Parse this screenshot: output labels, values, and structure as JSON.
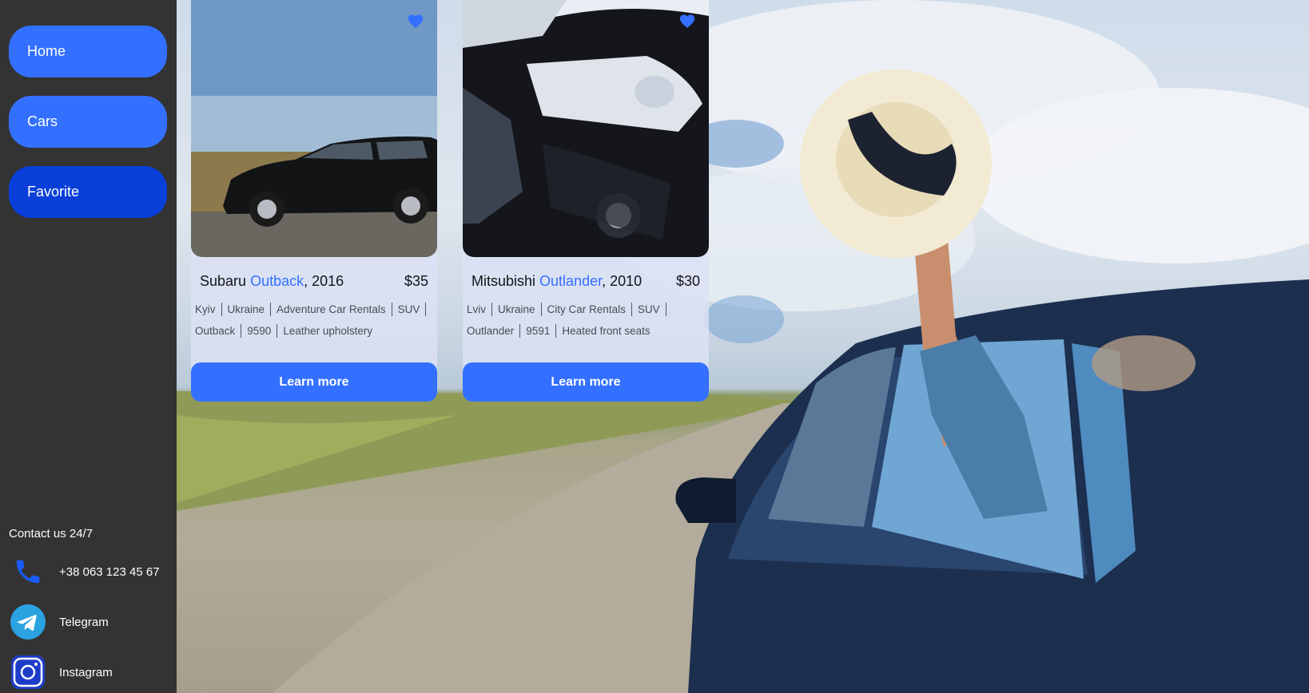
{
  "sidebar": {
    "nav": [
      {
        "label": "Home"
      },
      {
        "label": "Cars"
      },
      {
        "label": "Favorite"
      }
    ],
    "contact_title": "Contact us 24/7",
    "contacts": [
      {
        "label": "+38 063 123 45 67",
        "icon": "phone-icon"
      },
      {
        "label": "Telegram",
        "icon": "telegram-icon"
      },
      {
        "label": "Instagram",
        "icon": "instagram-icon"
      }
    ]
  },
  "cards": [
    {
      "make": "Subaru",
      "model": "Outback",
      "year": ", 2016",
      "price": "$35",
      "tags_line1": [
        "Kyiv",
        "Ukraine",
        "Adventure Car Rentals",
        "SUV"
      ],
      "tags_line2": [
        "Outback",
        "9590",
        "Leather upholstery"
      ],
      "button": "Learn more",
      "favorite": true
    },
    {
      "make": "Mitsubishi",
      "model": "Outlander",
      "year": ", 2010",
      "price": "$30",
      "tags_line1": [
        "Lviv",
        "Ukraine",
        "City Car Rentals",
        "SUV"
      ],
      "tags_line2": [
        "Outlander",
        "9591",
        "Heated front seats"
      ],
      "button": "Learn more",
      "favorite": true
    }
  ],
  "colors": {
    "accent": "#3470ff",
    "accent_active": "#0b3fd9",
    "sidebar_bg": "#333333"
  }
}
